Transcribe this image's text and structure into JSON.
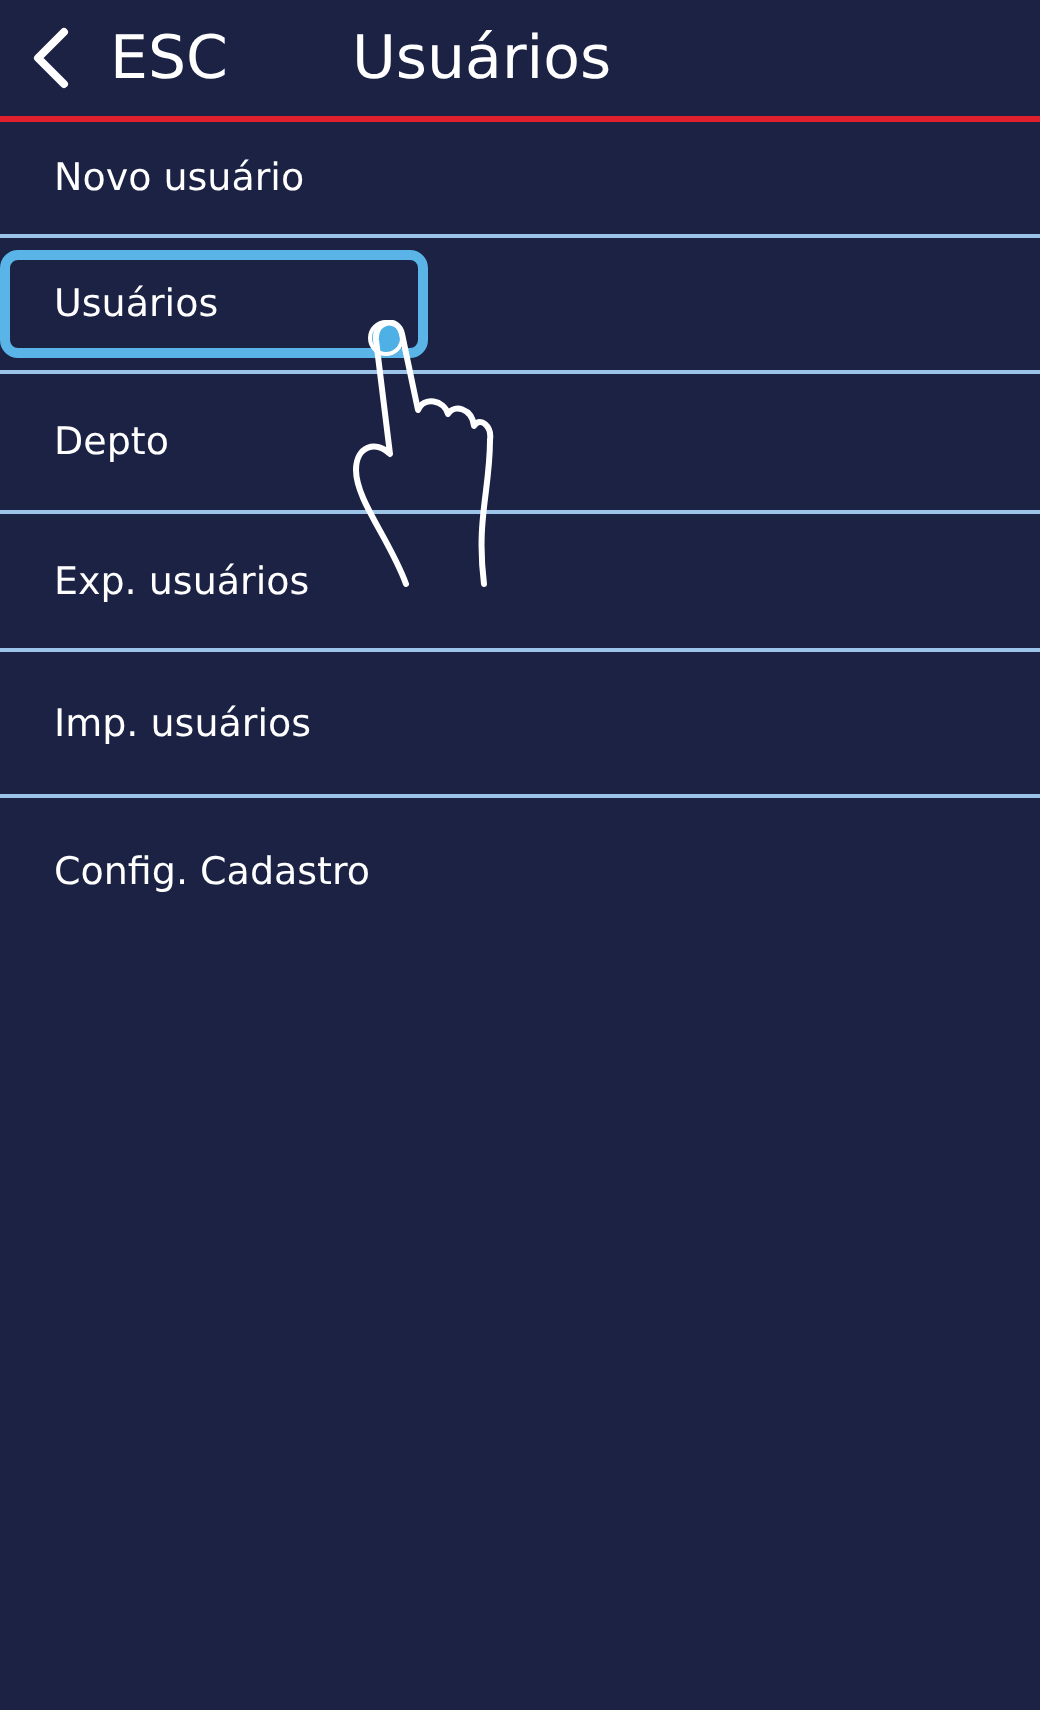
{
  "header": {
    "back_label": "ESC",
    "title": "Usuários"
  },
  "menu": [
    {
      "label": "Novo usuário",
      "selected": false
    },
    {
      "label": "Usuários",
      "selected": true
    },
    {
      "label": "Depto",
      "selected": false
    },
    {
      "label": "Exp. usuários",
      "selected": false
    },
    {
      "label": "Imp. usuários",
      "selected": false
    },
    {
      "label": "Config. Cadastro",
      "selected": false
    }
  ]
}
